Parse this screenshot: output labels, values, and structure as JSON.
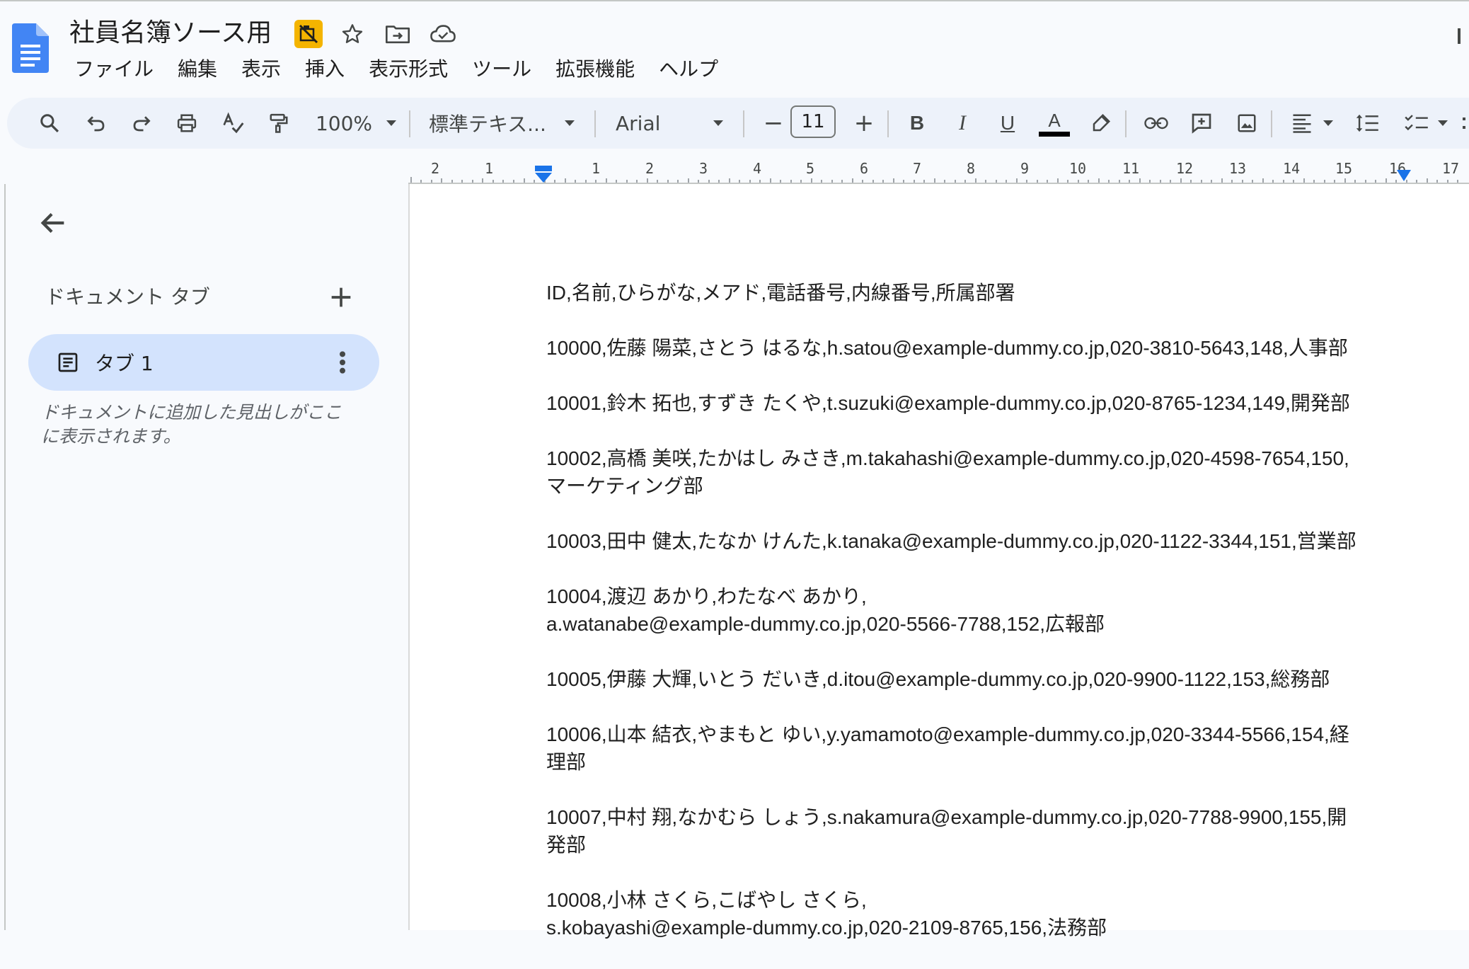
{
  "document": {
    "title": "社員名簿ソース用",
    "lines": [
      "ID,名前,ひらがな,メアド,電話番号,内線番号,所属部署",
      "10000,佐藤 陽菜,さとう はるな,h.satou@example-dummy.co.jp,020-3810-5643,148,人事部",
      "10001,鈴木 拓也,すずき たくや,t.suzuki@example-dummy.co.jp,020-8765-1234,149,開発部",
      "10002,高橋 美咲,たかはし みさき,m.takahashi@example-dummy.co.jp,020-4598-7654,150,\nマーケティング部",
      "10003,田中 健太,たなか けんた,k.tanaka@example-dummy.co.jp,020-1122-3344,151,営業部",
      "10004,渡辺 あかり,わたなべ あかり,\na.watanabe@example-dummy.co.jp,020-5566-7788,152,広報部",
      "10005,伊藤 大輝,いとう だいき,d.itou@example-dummy.co.jp,020-9900-1122,153,総務部",
      "10006,山本 結衣,やまもと ゆい,y.yamamoto@example-dummy.co.jp,020-3344-5566,154,経\n理部",
      "10007,中村 翔,なかむら しょう,s.nakamura@example-dummy.co.jp,020-7788-9900,155,開\n発部",
      "10008,小林 さくら,こばやし さくら,\ns.kobayashi@example-dummy.co.jp,020-2109-8765,156,法務部"
    ]
  },
  "menu": {
    "file": "ファイル",
    "edit": "編集",
    "view": "表示",
    "insert": "挿入",
    "format": "表示形式",
    "tools": "ツール",
    "extensions": "拡張機能",
    "help": "ヘルプ"
  },
  "toolbar": {
    "zoom": "100%",
    "style": "標準テキス...",
    "font": "Arial",
    "font_size": "11",
    "bold": "B",
    "italic": "I",
    "underline": "U",
    "text_color_label": "A",
    "minus": "−",
    "plus": "+"
  },
  "ruler": {
    "labels": [
      "2",
      "1",
      "1",
      "2",
      "3",
      "4",
      "5",
      "6",
      "7",
      "8",
      "9",
      "10",
      "11",
      "12",
      "13",
      "14",
      "15",
      "16",
      "17"
    ]
  },
  "sidebar": {
    "heading": "ドキュメント タブ",
    "tab_label": "タブ 1",
    "hint": "ドキュメントに追加した見出しがここに表示されます。"
  },
  "colors": {
    "accent": "#1a73e8",
    "tab_selected": "#d3e3fd",
    "toolbar_bg": "#edf2fa",
    "highlight_badge": "#f4b400"
  },
  "icons": [
    "docs-logo-icon",
    "no-highlight-icon",
    "star-icon",
    "move-folder-icon",
    "cloud-saved-icon",
    "search-icon",
    "undo-icon",
    "redo-icon",
    "print-icon",
    "spellcheck-icon",
    "paint-format-icon",
    "link-icon",
    "add-comment-icon",
    "insert-image-icon",
    "align-icon",
    "line-spacing-icon",
    "checklist-icon",
    "back-arrow-icon",
    "plus-icon",
    "document-icon",
    "more-vert-icon"
  ]
}
